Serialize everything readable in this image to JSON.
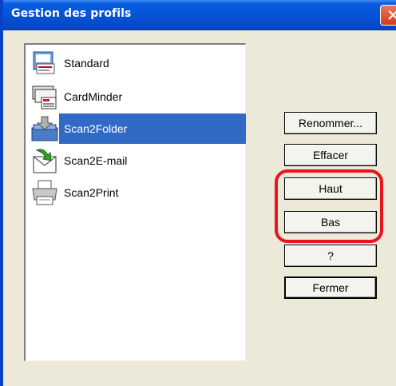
{
  "window": {
    "title": "Gestion des profils",
    "close_glyph": "✕"
  },
  "profiles": {
    "items": [
      {
        "label": "Standard",
        "icon": "standard-profile-icon"
      },
      {
        "label": "CardMinder",
        "icon": "cardminder-icon"
      },
      {
        "label": "Scan2Folder",
        "icon": "scan2folder-icon",
        "selected": true
      },
      {
        "label": "Scan2E-mail",
        "icon": "scan2email-icon"
      },
      {
        "label": "Scan2Print",
        "icon": "scan2print-icon"
      }
    ]
  },
  "buttons": {
    "rename": "Renommer...",
    "delete": "Effacer",
    "up": "Haut",
    "down": "Bas",
    "help": "?",
    "close": "Fermer"
  },
  "colors": {
    "selection": "#316ac5",
    "highlight": "#e8141e",
    "titlebar": "#0753d6"
  }
}
